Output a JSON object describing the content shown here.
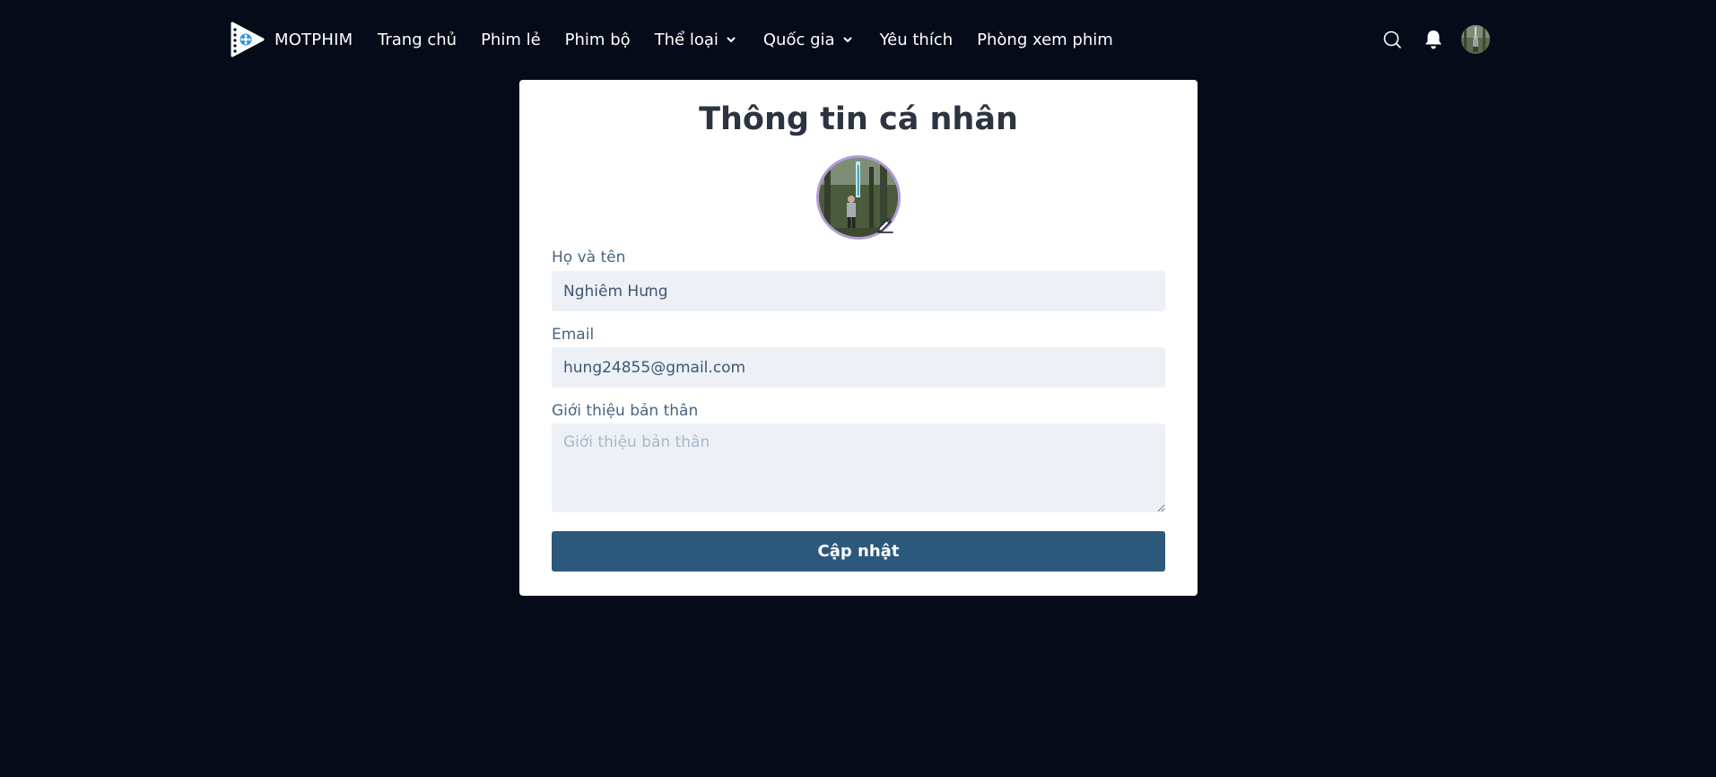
{
  "header": {
    "brand": "MOTPHIM",
    "nav": [
      {
        "label": "Trang chủ"
      },
      {
        "label": "Phim lẻ"
      },
      {
        "label": "Phim bộ"
      },
      {
        "label": "Thể loại"
      },
      {
        "label": "Quốc gia"
      },
      {
        "label": "Yêu thích"
      },
      {
        "label": "Phòng xem phim"
      }
    ],
    "icons": [
      "search-icon",
      "bell-icon",
      "user-avatar"
    ]
  },
  "profile": {
    "title": "Thông tin cá nhân",
    "fields": {
      "name": {
        "label": "Họ và tên",
        "value": "Nghiêm Hưng"
      },
      "email": {
        "label": "Email",
        "value": "hung24855@gmail.com"
      },
      "bio": {
        "label": "Giới thiệu bản thân",
        "value": "",
        "placeholder": "Giới thiệu bản thân"
      }
    },
    "submit_label": "Cập nhật"
  },
  "colors": {
    "background": "#060b1a",
    "card": "#ffffff",
    "button": "#2c587c",
    "input_bg": "#edf1f6",
    "avatar_ring": "#b39ad8"
  }
}
